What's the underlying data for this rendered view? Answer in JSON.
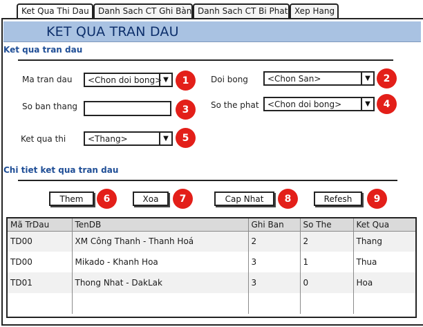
{
  "tabs": [
    {
      "label": "Ket Qua Thi Dau"
    },
    {
      "label": "Danh Sach CT Ghi Bàn"
    },
    {
      "label": "Danh Sach CT Bi Phat"
    },
    {
      "label": "Xep Hang"
    }
  ],
  "banner": {
    "title": "KET QUA TRAN DAU"
  },
  "section1": {
    "title": "Ket qua tran dau"
  },
  "form": {
    "match_id_label": "Ma tran dau",
    "match_id_value": "<Chon doi bong>",
    "team_label": "Doi bong",
    "team_value": "<Chon San>",
    "goals_label": "So ban thang",
    "goals_value": "",
    "cards_label": "So the phat",
    "cards_value": "<Chon doi bong>",
    "result_label": "Ket qua thi",
    "result_value": "<Thang>"
  },
  "badges": [
    "1",
    "2",
    "3",
    "4",
    "5",
    "6",
    "7",
    "8",
    "9"
  ],
  "section2": {
    "title": "Chi tiet ket qua tran dau"
  },
  "buttons": {
    "add": "Them",
    "delete": "Xoa",
    "update": "Cap Nhat",
    "refresh": "Refesh"
  },
  "table": {
    "columns": [
      "Mã TrDau",
      "TenDB",
      "Ghi Ban",
      "So The",
      "Ket Qua"
    ],
    "rows": [
      [
        "TD00",
        "XM Công Thanh - Thanh Hoá",
        "2",
        "2",
        "Thang"
      ],
      [
        "TD00",
        "Mikado - Khanh Hoa",
        "3",
        "1",
        "Thua"
      ],
      [
        "TD01",
        "Thong Nhat - DakLak",
        "3",
        "0",
        "Hoa"
      ]
    ]
  },
  "icons": {
    "dropdown": "triangle-down-icon"
  },
  "colors": {
    "banner": "#a9c2e2",
    "banner_text": "#0d2f6b",
    "section_title": "#1f4e96",
    "badge": "#e31f19"
  }
}
